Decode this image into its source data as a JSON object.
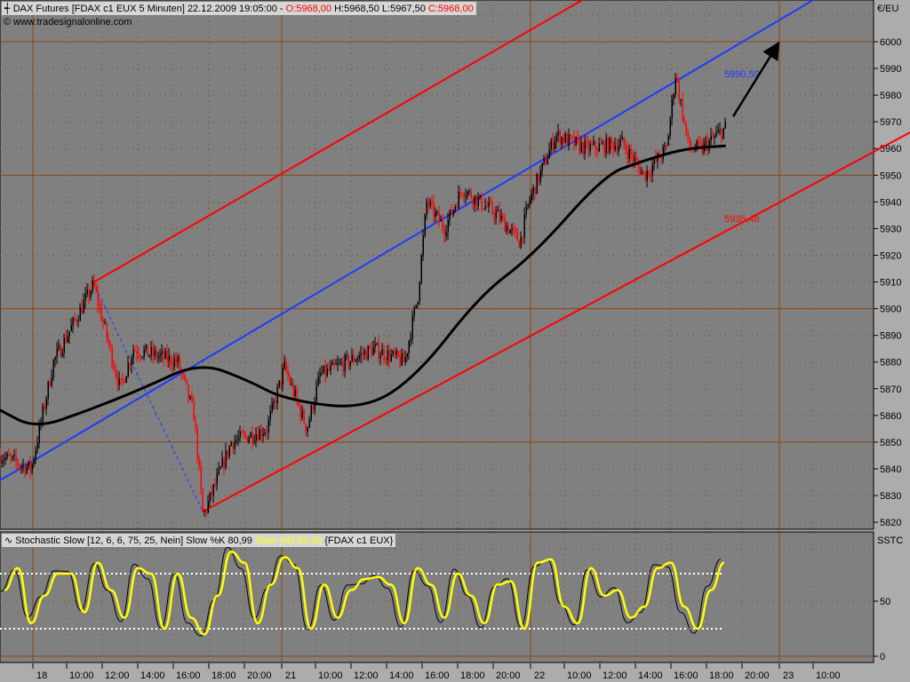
{
  "header": {
    "instrument": "DAX Futures [FDAX c1 EUX  5 Minuten]",
    "datetime": "22.12.2009 19:05:00 -",
    "open": "O:5968,00",
    "high": "H:5968,50",
    "low": "L:5967,50",
    "close": "C:5968,00",
    "copyright": "© www.tradesignalonline.com"
  },
  "stochastic_header": {
    "title": "Stochastic Slow [12, 6, 6, 75, 25, Nein]",
    "k_label": "Slow %K 80,99",
    "d_label": "Slow %D 85,29",
    "symbol": "{FDAX c1 EUX}"
  },
  "colors": {
    "background": "#808080",
    "frame": "#acacac",
    "grid": "#8b4513",
    "up": "#000000",
    "down": "#ff0000",
    "channel_mid": "#1a3cff",
    "channel_outer": "#ff0000",
    "ma": "#000000",
    "stoch_k": "#000000",
    "stoch_d": "#ffff00"
  },
  "chart_data": [
    {
      "type": "candlestick",
      "title": "DAX Futures [FDAX c1 EUX  5 Minuten]",
      "ylabel": "€/EU",
      "ylim": [
        5817,
        6015
      ],
      "yticks": [
        6000,
        5990,
        5980,
        5970,
        5960,
        5950,
        5940,
        5930,
        5920,
        5910,
        5900,
        5890,
        5880,
        5870,
        5860,
        5850,
        5840,
        5830,
        5820
      ],
      "xticks": [
        "18",
        "10:00",
        "12:00",
        "14:00",
        "16:00",
        "18:00",
        "20:00",
        "21",
        "10:00",
        "12:00",
        "14:00",
        "16:00",
        "18:00",
        "20:00",
        "22",
        "10:00",
        "12:00",
        "14:00",
        "16:00",
        "18:00",
        "20:00",
        "23",
        "10:00"
      ],
      "grid": true,
      "price_path": [
        {
          "time": "17 20:15",
          "price": 5845
        },
        {
          "time": "17 22:00",
          "price": 5840
        },
        {
          "time": "18 09:15",
          "price": 5880
        },
        {
          "time": "18 11:30",
          "price": 5909
        },
        {
          "time": "18 13:00",
          "price": 5870
        },
        {
          "time": "18 13:45",
          "price": 5885
        },
        {
          "time": "18 16:15",
          "price": 5880
        },
        {
          "time": "18 17:10",
          "price": 5860
        },
        {
          "time": "18 17:40",
          "price": 5822
        },
        {
          "time": "18 19:15",
          "price": 5850
        },
        {
          "time": "18 21:15",
          "price": 5855
        },
        {
          "time": "21 08:15",
          "price": 5878
        },
        {
          "time": "21 09:30",
          "price": 5855
        },
        {
          "time": "21 10:15",
          "price": 5875
        },
        {
          "time": "21 13:15",
          "price": 5885
        },
        {
          "time": "21 15:00",
          "price": 5880
        },
        {
          "time": "21 15:45",
          "price": 5905
        },
        {
          "time": "21 16:15",
          "price": 5940
        },
        {
          "time": "21 17:15",
          "price": 5930
        },
        {
          "time": "21 18:15",
          "price": 5945
        },
        {
          "time": "21 20:15",
          "price": 5935
        },
        {
          "time": "21 21:30",
          "price": 5925
        },
        {
          "time": "21 22:00",
          "price": 5940
        },
        {
          "time": "22 09:30",
          "price": 5965
        },
        {
          "time": "22 11:15",
          "price": 5960
        },
        {
          "time": "22 13:15",
          "price": 5962
        },
        {
          "time": "22 14:30",
          "price": 5950
        },
        {
          "time": "22 15:45",
          "price": 5960
        },
        {
          "time": "22 16:15",
          "price": 5988
        },
        {
          "time": "22 17:00",
          "price": 5960
        },
        {
          "time": "22 17:45",
          "price": 5960
        },
        {
          "time": "22 19:05",
          "price": 5968
        }
      ],
      "moving_average": [
        {
          "time": "17 20:15",
          "price": 5862
        },
        {
          "time": "18 08:15",
          "price": 5855
        },
        {
          "time": "18 11:15",
          "price": 5862
        },
        {
          "time": "18 14:15",
          "price": 5870
        },
        {
          "time": "18 17:30",
          "price": 5880
        },
        {
          "time": "18 20:15",
          "price": 5873
        },
        {
          "time": "21 08:15",
          "price": 5866
        },
        {
          "time": "21 12:45",
          "price": 5862
        },
        {
          "time": "21 15:45",
          "price": 5875
        },
        {
          "time": "21 19:15",
          "price": 5905
        },
        {
          "time": "22 08:15",
          "price": 5920
        },
        {
          "time": "22 12:15",
          "price": 5950
        },
        {
          "time": "22 14:15",
          "price": 5955
        },
        {
          "time": "22 16:45",
          "price": 5960
        },
        {
          "time": "22 19:05",
          "price": 5961
        }
      ],
      "channel": {
        "middle": [
          {
            "time": "17 20:00",
            "price": 5834.7
          },
          {
            "time": "23 10:00",
            "price": 6015.6
          }
        ],
        "upper": [
          {
            "time": "18 11:30",
            "price": 5909.8
          },
          {
            "time": "22 11:00",
            "price": 6015.6
          }
        ],
        "lower": [
          {
            "time": "18 17:40",
            "price": 5824
          },
          {
            "time": "23 16:00",
            "price": 5968
          }
        ],
        "connector": [
          {
            "time": "18 11:30",
            "price": 5909.8
          },
          {
            "time": "18 17:40",
            "price": 5824
          }
        ],
        "middle_label": "5990,59",
        "lower_label": "5935,48"
      },
      "arrow": [
        {
          "time": "22 19:30",
          "price": 5972
        },
        {
          "time": "22 21:55",
          "price": 5998
        }
      ]
    },
    {
      "type": "line",
      "title": "Stochastic Slow [12, 6, 6, 75, 25, Nein]",
      "ylabel": "SSTC",
      "ylim": [
        0,
        100
      ],
      "yticks": [
        50,
        0
      ],
      "levels": [
        75,
        25
      ],
      "series": [
        {
          "name": "Slow %D",
          "values": [
            60,
            80,
            30,
            55,
            75,
            75,
            40,
            85,
            60,
            35,
            80,
            75,
            25,
            75,
            35,
            20,
            55,
            95,
            85,
            30,
            65,
            90,
            80,
            25,
            65,
            35,
            60,
            70,
            72,
            65,
            30,
            80,
            65,
            35,
            75,
            55,
            30,
            65,
            68,
            25,
            85,
            88,
            45,
            30,
            80,
            55,
            60,
            35,
            45,
            80,
            85,
            45,
            25,
            60,
            85
          ]
        },
        {
          "name": "Slow %K",
          "last": 80.99
        }
      ]
    }
  ]
}
